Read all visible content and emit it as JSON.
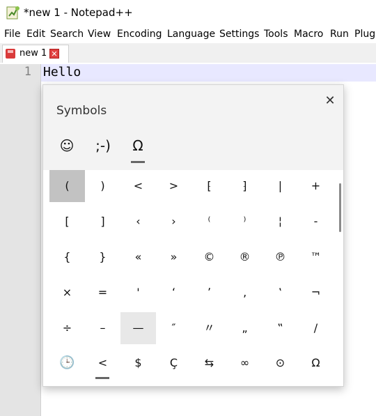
{
  "window": {
    "title": "*new 1 - Notepad++"
  },
  "menu": [
    "File",
    "Edit",
    "Search",
    "View",
    "Encoding",
    "Language",
    "Settings",
    "Tools",
    "Macro",
    "Run",
    "Plug"
  ],
  "tab": {
    "label": "new 1",
    "close_glyph": "✕"
  },
  "editor": {
    "line_number": "1",
    "text": "Hello"
  },
  "symbols_panel": {
    "title": "Symbols",
    "close_glyph": "✕",
    "categories": [
      {
        "label": "☺",
        "icon": "emoji-icon"
      },
      {
        "label": ";-)",
        "icon": "kaomoji-icon"
      },
      {
        "label": "Ω",
        "icon": "symbols-icon",
        "active": true
      }
    ],
    "rows": [
      [
        "(",
        ")",
        "<",
        ">",
        "⁅",
        "⁆",
        "|",
        "+"
      ],
      [
        "[",
        "]",
        "‹",
        "›",
        "⁽",
        "⁾",
        "¦",
        "-"
      ],
      [
        "{",
        "}",
        "«",
        "»",
        "©",
        "®",
        "℗",
        "™"
      ],
      [
        "×",
        "=",
        "'",
        "ʻ",
        "ʼ",
        "‚",
        "‛",
        "¬"
      ],
      [
        "÷",
        "–",
        "—",
        "″",
        "〃",
        "„",
        "‟",
        "/"
      ]
    ],
    "selected_cell": "(",
    "hover_cell": "—",
    "sub_categories": [
      {
        "label": "🕒",
        "icon": "recent-icon"
      },
      {
        "label": "<",
        "icon": "brackets-category",
        "active": true
      },
      {
        "label": "$",
        "icon": "currency-category"
      },
      {
        "label": "Ç",
        "icon": "latin-category"
      },
      {
        "label": "⇆",
        "icon": "arrows-category"
      },
      {
        "label": "∞",
        "icon": "math-category"
      },
      {
        "label": "⊙",
        "icon": "geometric-category"
      },
      {
        "label": "Ω",
        "icon": "greek-category"
      }
    ]
  }
}
